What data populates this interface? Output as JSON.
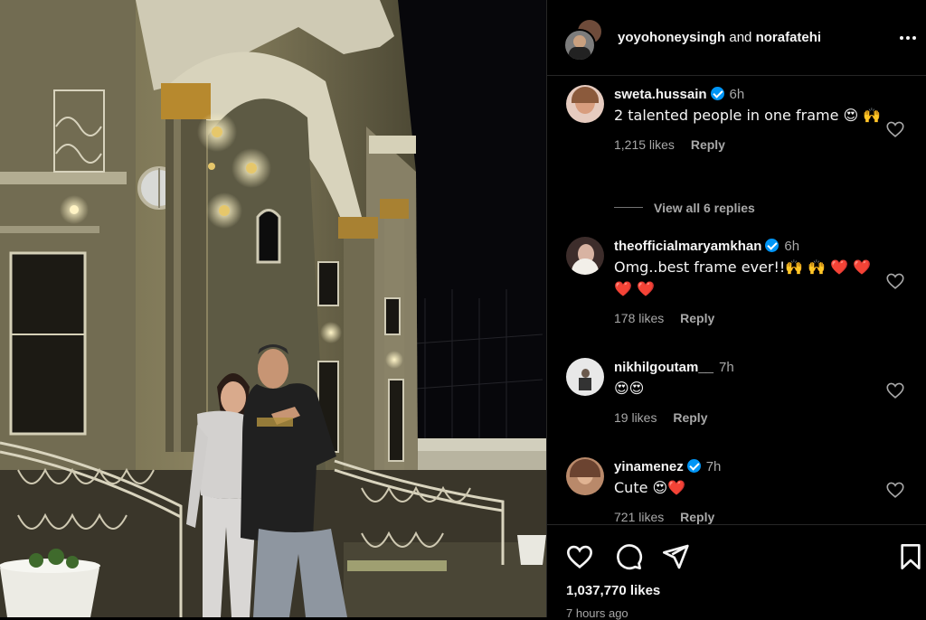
{
  "post": {
    "header": {
      "user1": "yoyohoneysingh",
      "joiner": "and",
      "user2": "norafatehi",
      "more_label": "More options"
    },
    "comments": [
      {
        "username": "sweta.hussain",
        "verified": true,
        "time": "6h",
        "text": "2 talented people in one frame 😍 🙌",
        "likes": "1,215 likes",
        "reply": "Reply"
      },
      {
        "username": "theofficialmaryamkhan",
        "verified": true,
        "time": "6h",
        "text": "Omg..best frame ever!!🙌 🙌 ❤️ ❤️ ❤️ ❤️",
        "likes": "178 likes",
        "reply": "Reply"
      },
      {
        "username": "nikhilgoutam__",
        "verified": false,
        "time": "7h",
        "text": "😍😍",
        "likes": "19 likes",
        "reply": "Reply"
      },
      {
        "username": "yinamenez",
        "verified": true,
        "time": "7h",
        "text": "Cute 😍❤️",
        "likes": "721 likes",
        "reply": "Reply"
      }
    ],
    "view_replies": "View all 6 replies",
    "total_likes": "1,037,770 likes",
    "posted": "7 hours ago",
    "colors": {
      "accent": "#0095f6",
      "heart": "#ed4956",
      "muted": "#a8a8a8"
    }
  }
}
